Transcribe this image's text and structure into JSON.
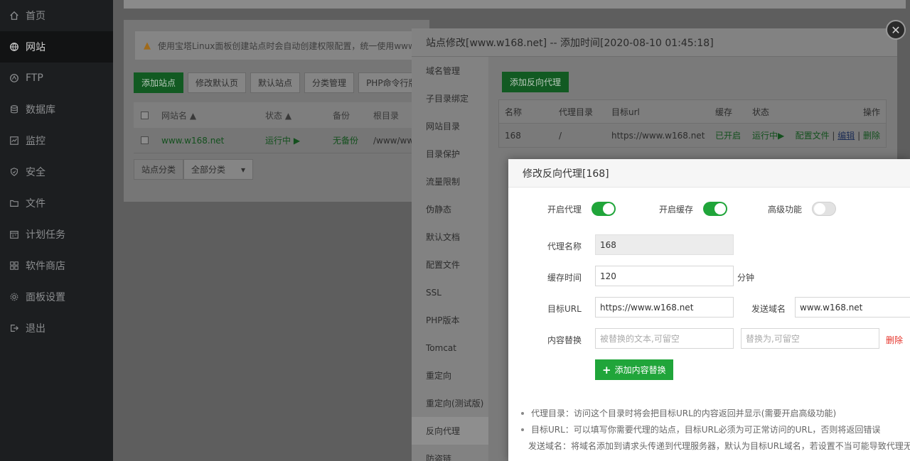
{
  "sidebar": {
    "items": [
      {
        "label": "首页",
        "icon": "home-icon"
      },
      {
        "label": "网站",
        "icon": "globe-icon",
        "active": true
      },
      {
        "label": "FTP",
        "icon": "ftp-icon"
      },
      {
        "label": "数据库",
        "icon": "database-icon"
      },
      {
        "label": "监控",
        "icon": "monitor-icon"
      },
      {
        "label": "安全",
        "icon": "shield-icon"
      },
      {
        "label": "文件",
        "icon": "folder-icon"
      },
      {
        "label": "计划任务",
        "icon": "calendar-icon"
      },
      {
        "label": "软件商店",
        "icon": "apps-icon"
      },
      {
        "label": "面板设置",
        "icon": "gear-icon"
      },
      {
        "label": "退出",
        "icon": "logout-icon"
      }
    ]
  },
  "site_panel": {
    "notice": "使用宝塔Linux面板创建站点时会自动创建权限配置，统一使用www用",
    "buttons": [
      "添加站点",
      "修改默认页",
      "默认站点",
      "分类管理",
      "PHP命令行版本"
    ],
    "table_headers": [
      "网站名",
      "状态",
      "备份",
      "根目录"
    ],
    "row": {
      "name": "www.w168.net",
      "status": "运行中 ▶",
      "backup": "无备份",
      "root": "/www/ww"
    },
    "category_label": "站点分类",
    "category_value": "全部分类"
  },
  "site_dialog": {
    "title": "站点修改[www.w168.net] -- 添加时间[2020-08-10 01:45:18]",
    "tabs": [
      "域名管理",
      "子目录绑定",
      "网站目录",
      "目录保护",
      "流量限制",
      "伪静态",
      "默认文档",
      "配置文件",
      "SSL",
      "PHP版本",
      "Tomcat",
      "重定向",
      "重定向(测试版)",
      "反向代理",
      "防盗链"
    ],
    "active_tab": "反向代理",
    "add_proxy_label": "添加反向代理",
    "proxy_headers": {
      "name": "名称",
      "dir": "代理目录",
      "url": "目标url",
      "cache": "缓存",
      "status": "状态",
      "action": "操作"
    },
    "proxy_row": {
      "name": "168",
      "dir": "/",
      "url": "https://www.w168.net",
      "cache": "已开启",
      "status": "运行中▶",
      "config": "配置文件",
      "edit": "编辑",
      "delete": "删除"
    }
  },
  "edit_dialog": {
    "title": "修改反向代理[168]",
    "enable_proxy_label": "开启代理",
    "enable_cache_label": "开启缓存",
    "advanced_label": "高级功能",
    "proxy_name_label": "代理名称",
    "proxy_name_value": "168",
    "cache_time_label": "缓存时间",
    "cache_time_value": "120",
    "cache_time_unit": "分钟",
    "target_url_label": "目标URL",
    "target_url_value": "https://www.w168.net",
    "send_domain_label": "发送域名",
    "send_domain_value": "www.w168.net",
    "replace_label": "内容替换",
    "replace_from_placeholder": "被替换的文本,可留空",
    "replace_to_placeholder": "替换为,可留空",
    "replace_delete": "删除",
    "add_replace_label": "添加内容替换",
    "tips": [
      "代理目录：访问这个目录时将会把目标URL的内容返回并显示(需要开启高级功能)",
      "目标URL：可以填写你需要代理的站点，目标URL必须为可正常访问的URL，否则将返回错误",
      "发送域名：将域名添加到请求头传递到代理服务器，默认为目标URL域名，若设置不当可能导致代理无法"
    ]
  },
  "colors": {
    "accent": "#20a53a",
    "danger": "#e6332a",
    "sidebar": "#1c1e20"
  }
}
